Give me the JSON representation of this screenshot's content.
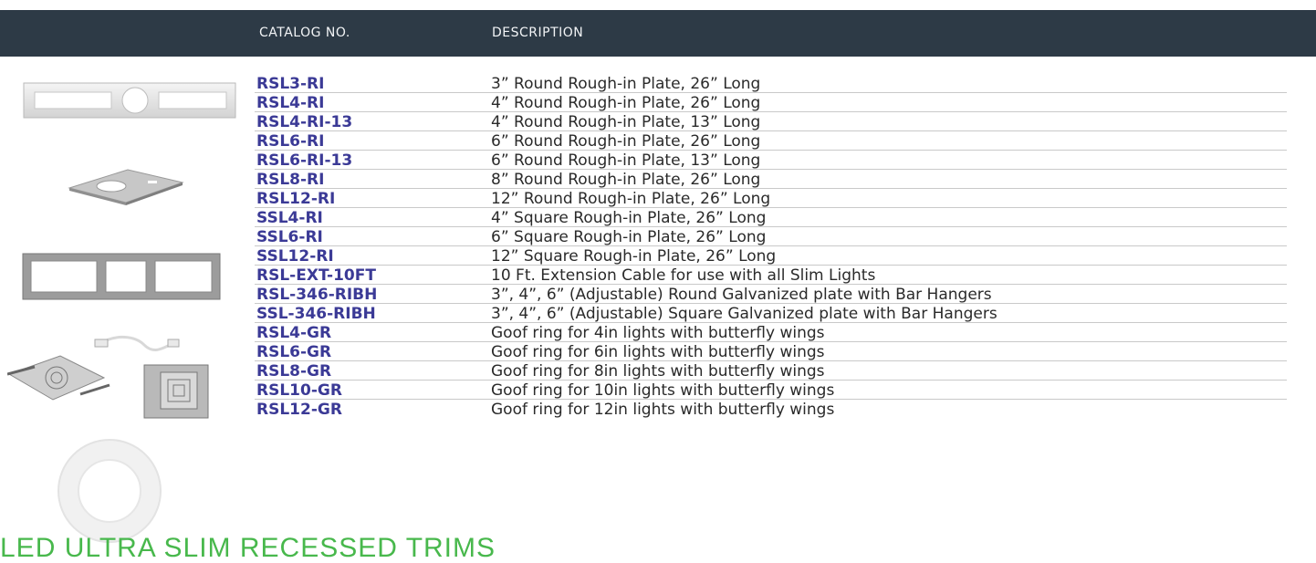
{
  "header": {
    "catalog_label": "CATALOG NO.",
    "description_label": "DESCRIPTION"
  },
  "rows": [
    {
      "catalog": "RSL3-RI",
      "description": "3” Round Rough-in Plate, 26” Long"
    },
    {
      "catalog": "RSL4-RI",
      "description": "4” Round Rough-in Plate, 26” Long"
    },
    {
      "catalog": "RSL4-RI-13",
      "description": "4” Round Rough-in Plate, 13” Long"
    },
    {
      "catalog": "RSL6-RI",
      "description": "6” Round Rough-in Plate, 26” Long"
    },
    {
      "catalog": "RSL6-RI-13",
      "description": "6” Round Rough-in Plate, 13” Long"
    },
    {
      "catalog": "RSL8-RI",
      "description": "8” Round Rough-in Plate, 26” Long"
    },
    {
      "catalog": "RSL12-RI",
      "description": "12” Round Rough-in Plate, 26” Long"
    },
    {
      "catalog": "SSL4-RI",
      "description": "4” Square Rough-in Plate, 26” Long"
    },
    {
      "catalog": "SSL6-RI",
      "description": "6” Square Rough-in Plate, 26” Long"
    },
    {
      "catalog": "SSL12-RI",
      "description": "12” Square Rough-in Plate, 26” Long"
    },
    {
      "catalog": "RSL-EXT-10FT",
      "description": "10 Ft. Extension Cable for use with all Slim Lights"
    },
    {
      "catalog": "RSL-346-RIBH",
      "description": "3”, 4”, 6” (Adjustable) Round Galvanized plate with Bar Hangers"
    },
    {
      "catalog": "SSL-346-RIBH",
      "description": "3”, 4”, 6” (Adjustable) Square Galvanized plate with Bar Hangers"
    },
    {
      "catalog": "RSL4-GR",
      "description": "Goof ring for 4in lights with butterfly wings"
    },
    {
      "catalog": "RSL6-GR",
      "description": "Goof ring for 6in lights with butterfly wings"
    },
    {
      "catalog": "RSL8-GR",
      "description": "Goof ring for 8in lights with butterfly wings"
    },
    {
      "catalog": "RSL10-GR",
      "description": "Goof ring for 10in lights with butterfly wings"
    },
    {
      "catalog": "RSL12-GR",
      "description": "Goof ring for 12in lights with butterfly wings"
    }
  ],
  "footer": {
    "section_title": "LED ULTRA SLIM RECESSED TRIMS"
  }
}
